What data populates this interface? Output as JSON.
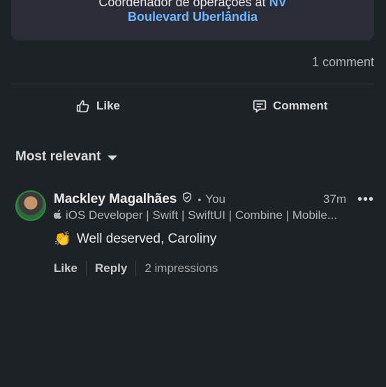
{
  "card": {
    "line1_prefix": "Coordenador de operações at",
    "line1_link": "NV",
    "line2": "Boulevard Uberlândia"
  },
  "comment_count": "1 comment",
  "actions": {
    "like": "Like",
    "comment": "Comment"
  },
  "sort": {
    "label": "Most relevant"
  },
  "comment": {
    "author": "Mackley Magalhães",
    "relation": "You",
    "time": "37m",
    "headline": "iOS Developer | Swift | SwiftUI | Combine | Mobile...",
    "text": "Well deserved, Caroliny",
    "emoji": "👏",
    "like_label": "Like",
    "reply_label": "Reply",
    "impressions": "2 impressions"
  },
  "icons": {
    "like": "thumbs-up-icon",
    "comment": "comment-bubble-icon",
    "verified": "verified-shield-icon",
    "more": "more-dots-icon",
    "apple": "apple-icon"
  },
  "colors": {
    "background": "#1d2226",
    "link": "#6fb6ff",
    "card": "#2a2c38"
  }
}
